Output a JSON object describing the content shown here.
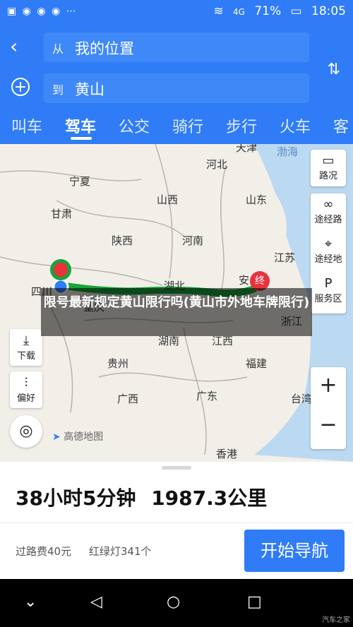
{
  "status_bar": {
    "battery": "71%",
    "time": "18:05",
    "net1": "4G",
    "net2": "4G",
    "icons": [
      "notification-icon",
      "wechat-icon",
      "wechat-icon",
      "wechat-icon",
      "more-icon"
    ]
  },
  "route_inputs": {
    "from_prefix": "从",
    "from_value": "我的位置",
    "to_prefix": "到",
    "to_value": "黄山"
  },
  "tabs": [
    {
      "label": "叫车",
      "active": false
    },
    {
      "label": "驾车",
      "active": true
    },
    {
      "label": "公交",
      "active": false
    },
    {
      "label": "骑行",
      "active": false
    },
    {
      "label": "步行",
      "active": false
    },
    {
      "label": "火车",
      "active": false
    },
    {
      "label": "客",
      "active": false
    }
  ],
  "map": {
    "labels": [
      {
        "text": "宁夏"
      },
      {
        "text": "甘肃"
      },
      {
        "text": "山西"
      },
      {
        "text": "河北"
      },
      {
        "text": "山东"
      },
      {
        "text": "陕西"
      },
      {
        "text": "河南"
      },
      {
        "text": "江苏"
      },
      {
        "text": "湖北"
      },
      {
        "text": "安"
      },
      {
        "text": "四川"
      },
      {
        "text": "重庆"
      },
      {
        "text": "浙江"
      },
      {
        "text": "湖南"
      },
      {
        "text": "江西"
      },
      {
        "text": "贵州"
      },
      {
        "text": "福建"
      },
      {
        "text": "广西"
      },
      {
        "text": "广东"
      },
      {
        "text": "台湾"
      },
      {
        "text": "香港"
      },
      {
        "text": "天津"
      },
      {
        "text": "渤海"
      }
    ],
    "end_marker": "终",
    "map_logo": "高德地图"
  },
  "right_controls": {
    "traffic": "路况",
    "route_road": "途经路",
    "route_place": "途经地",
    "service": "服务区"
  },
  "left_controls": {
    "download": "下载",
    "preference": "偏好"
  },
  "zoom": {
    "plus": "+",
    "minus": "−"
  },
  "overlay_title": "限号最新规定黄山限行吗(黄山市外地车牌限行)",
  "route_summary": {
    "duration": "38小时5分钟",
    "distance": "1987.3公里",
    "toll": "过路费40元",
    "lights": "红绿灯341个"
  },
  "start_button": "开始导航",
  "watermark": "汽车之家",
  "colors": {
    "primary": "#2f7cf6",
    "route": "#1aa33a",
    "end_marker": "#e8323c"
  }
}
